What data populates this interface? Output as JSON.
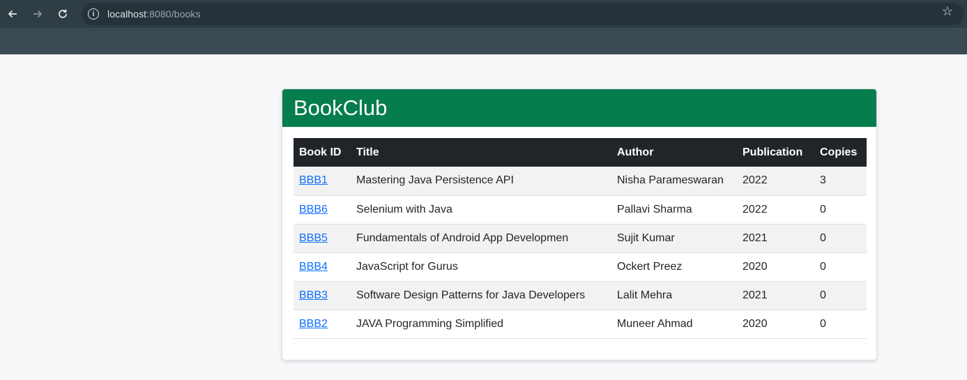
{
  "browser": {
    "url_host": "localhost",
    "url_rest": ":8080/books"
  },
  "app": {
    "title": "BookClub"
  },
  "table": {
    "headers": [
      "Book ID",
      "Title",
      "Author",
      "Publication",
      "Copies"
    ],
    "rows": [
      {
        "id": "BBB1",
        "title": "Mastering Java Persistence API",
        "author": "Nisha Parameswaran",
        "publication": "2022",
        "copies": "3"
      },
      {
        "id": "BBB6",
        "title": "Selenium with Java",
        "author": "Pallavi Sharma",
        "publication": "2022",
        "copies": "0"
      },
      {
        "id": "BBB5",
        "title": "Fundamentals of Android App Developmen",
        "author": "Sujit Kumar",
        "publication": "2021",
        "copies": "0"
      },
      {
        "id": "BBB4",
        "title": "JavaScript for Gurus",
        "author": "Ockert Preez",
        "publication": "2020",
        "copies": "0"
      },
      {
        "id": "BBB3",
        "title": "Software Design Patterns for Java Developers",
        "author": "Lalit Mehra",
        "publication": "2021",
        "copies": "0"
      },
      {
        "id": "BBB2",
        "title": "JAVA Programming Simplified",
        "author": "Muneer Ahmad",
        "publication": "2020",
        "copies": "0"
      }
    ]
  },
  "colors": {
    "header_green": "#057d4d",
    "table_head": "#212529",
    "link": "#0d6efd"
  }
}
